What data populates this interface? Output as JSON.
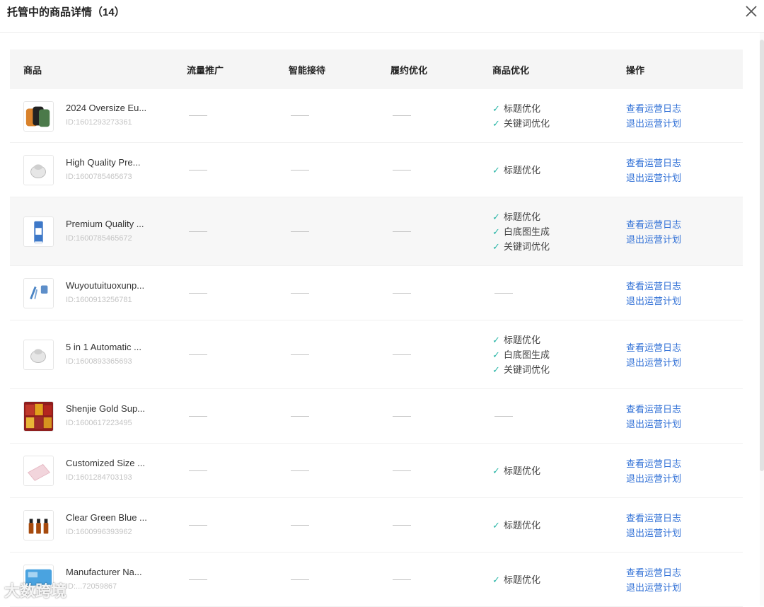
{
  "modal": {
    "title": "托管中的商品详情（14）"
  },
  "table": {
    "headers": {
      "goods": "商品",
      "traffic": "流量推广",
      "chat": "智能接待",
      "fulfill": "履约优化",
      "opt": "商品优化",
      "op": "操作"
    },
    "dash": "——",
    "op_view_log": "查看运营日志",
    "op_exit_plan": "退出运营计划",
    "rows": [
      {
        "name": "2024 Oversize Eu...",
        "id": "ID:1601293273361",
        "optimizations": [
          "标题优化",
          "关键词优化"
        ],
        "thumb_icon": "sweaters-image"
      },
      {
        "name": "High Quality Pre...",
        "id": "ID:1600785465673",
        "optimizations": [
          "标题优化"
        ],
        "thumb_icon": "white-device-image"
      },
      {
        "name": "Premium Quality ...",
        "id": "ID:1600785465672",
        "optimizations": [
          "标题优化",
          "白底图生成",
          "关键词优化"
        ],
        "thumb_icon": "blue-bottle-image"
      },
      {
        "name": "Wuyoutuituoxunp...",
        "id": "ID:1600913256781",
        "optimizations": [],
        "thumb_icon": "cosmetic-tools-image"
      },
      {
        "name": "5 in 1 Automatic ...",
        "id": "ID:1600893365693",
        "optimizations": [
          "标题优化",
          "白底图生成",
          "关键词优化"
        ],
        "thumb_icon": "white-device-image"
      },
      {
        "name": "Shenjie Gold Sup...",
        "id": "ID:1600617223495",
        "optimizations": [],
        "thumb_icon": "red-gold-boxes-image"
      },
      {
        "name": "Customized Size ...",
        "id": "ID:1601284703193",
        "optimizations": [
          "标题优化"
        ],
        "thumb_icon": "pink-mat-image"
      },
      {
        "name": "Clear Green Blue ...",
        "id": "ID:1600996393962",
        "optimizations": [
          "标题优化"
        ],
        "thumb_icon": "amber-bottles-image"
      },
      {
        "name": "Manufacturer Na...",
        "id": "ID:...72059867",
        "optimizations": [
          "标题优化"
        ],
        "thumb_icon": "blue-packs-image"
      }
    ]
  },
  "watermark": "大数跨境",
  "colors": {
    "check": "#2db7a8",
    "link": "#2f6fd6",
    "header_bg": "#f5f5f5"
  }
}
